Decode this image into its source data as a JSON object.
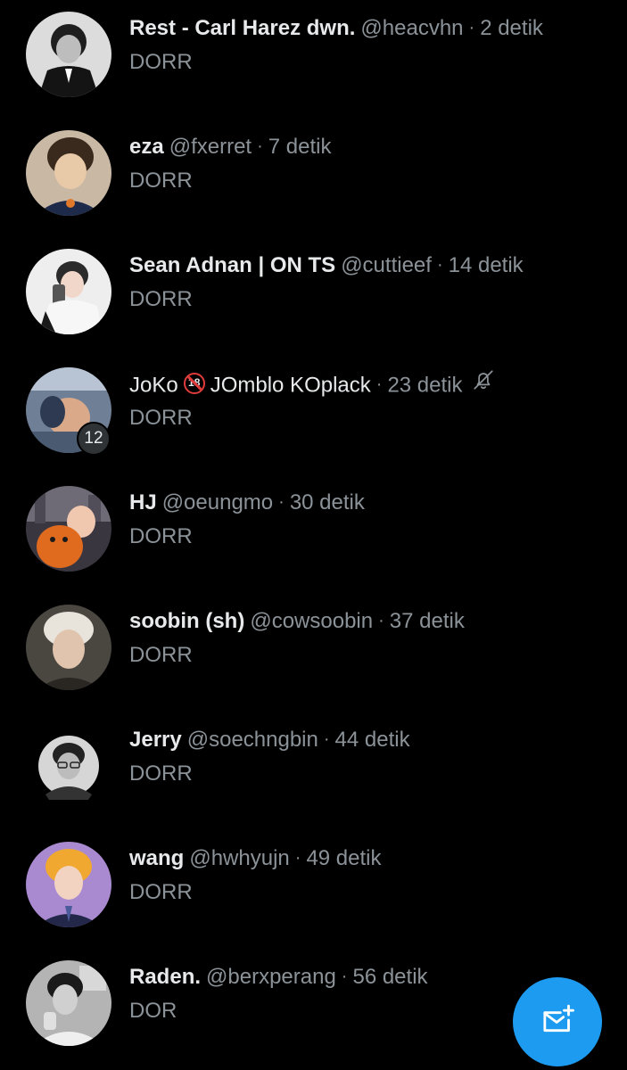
{
  "conversations": [
    {
      "name": "Rest - Carl Harez dwn.",
      "handle": "@heacvhn",
      "time": "2 detik",
      "message": "DORR"
    },
    {
      "name": "eza",
      "handle": "@fxerret",
      "time": "7 detik",
      "message": "DORR"
    },
    {
      "name": "Sean Adnan | ON TS",
      "handle": "@cuttieef",
      "time": "14 detik",
      "message": "DORR"
    },
    {
      "name_part1": "JoKo",
      "name_part2": "JOmblo KOplack",
      "adult_badge": "18",
      "time": "23 detik",
      "message": "DORR",
      "member_count": "12",
      "muted": true
    },
    {
      "name": "HJ",
      "handle": "@oeungmo",
      "time": "30 detik",
      "message": "DORR"
    },
    {
      "name": "soobin (sh)",
      "handle": "@cowsoobin",
      "time": "37 detik",
      "message": "DORR"
    },
    {
      "name": "Jerry",
      "handle": "@soechngbin",
      "time": "44 detik",
      "message": "DORR"
    },
    {
      "name": "wang",
      "handle": "@hwhyujn",
      "time": "49 detik",
      "message": "DORR"
    },
    {
      "name": "Raden.",
      "handle": "@berxperang",
      "time": "56 detik",
      "message": "DOR"
    }
  ],
  "separator": "·",
  "icons": {
    "mute": "bell-off-icon",
    "compose": "new-message-icon"
  },
  "colors": {
    "background": "#000000",
    "primary_text": "#e7e9ea",
    "secondary_text": "#8b9298",
    "accent": "#1d9bf0"
  }
}
